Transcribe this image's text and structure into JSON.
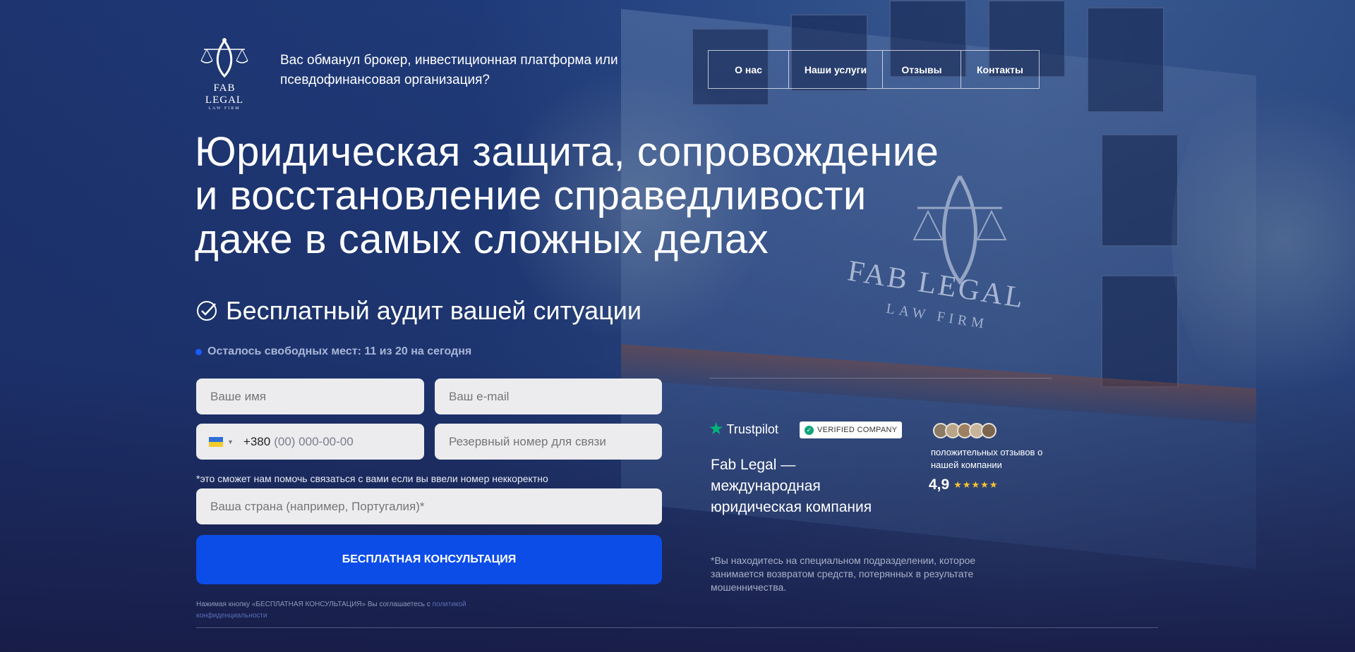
{
  "header": {
    "logo_name": "FAB LEGAL",
    "logo_sub": "LAW FIRM",
    "tagline": "Вас обманул брокер, инвестиционная платформа или псевдофинансовая организация?",
    "nav": [
      {
        "label": "О нас"
      },
      {
        "label": "Наши услуги"
      },
      {
        "label": "Отзывы"
      },
      {
        "label": "Контакты"
      }
    ]
  },
  "hero": {
    "title_lines": [
      "Юридическая защита, сопровождение",
      "и восстановление справедливости",
      "даже в самых сложных делах"
    ],
    "audit_text": "Бесплатный аудит вашей ситуации",
    "slots_text": "Осталось свободных мест: 11 из 20 на сегодня"
  },
  "form": {
    "name_placeholder": "Ваше имя",
    "email_placeholder": "Ваш e-mail",
    "phone_code": "+380",
    "phone_mask": "(00) 000-00-00",
    "backup_placeholder": "Резервный номер для связи",
    "note": "*это сможет нам помочь связаться с вами если вы ввели номер неккоректно",
    "country_placeholder": "Ваша страна (например, Португалия)*",
    "submit_label": "БЕСПЛАТНАЯ КОНСУЛЬТАЦИЯ",
    "consent_text": "Нажимая кнопку «БЕСПЛАТНАЯ КОНСУЛЬТАЦИЯ» Вы соглашаетесь с",
    "consent_link": "политикой конфиденциальности"
  },
  "trust": {
    "trustpilot_label": "Trustpilot",
    "verified_label": "VERIFIED COMPANY",
    "company_text": "Fab Legal — международная юридическая компания",
    "reviews_label": "положительных отзывов о нашей компании",
    "rating_value": "4,9",
    "rating_stars": "★★★★★",
    "disclaimer": "*Вы находитесь на специальном подразделении, которое занимается возвратом средств, потерянных в результате мошенничества."
  },
  "background_sign": {
    "title": "FAB LEGAL",
    "sub": "LAW FIRM"
  },
  "colors": {
    "accent": "#0c4de8",
    "trustpilot_green": "#00b67a",
    "star_gold": "#f5c431"
  }
}
